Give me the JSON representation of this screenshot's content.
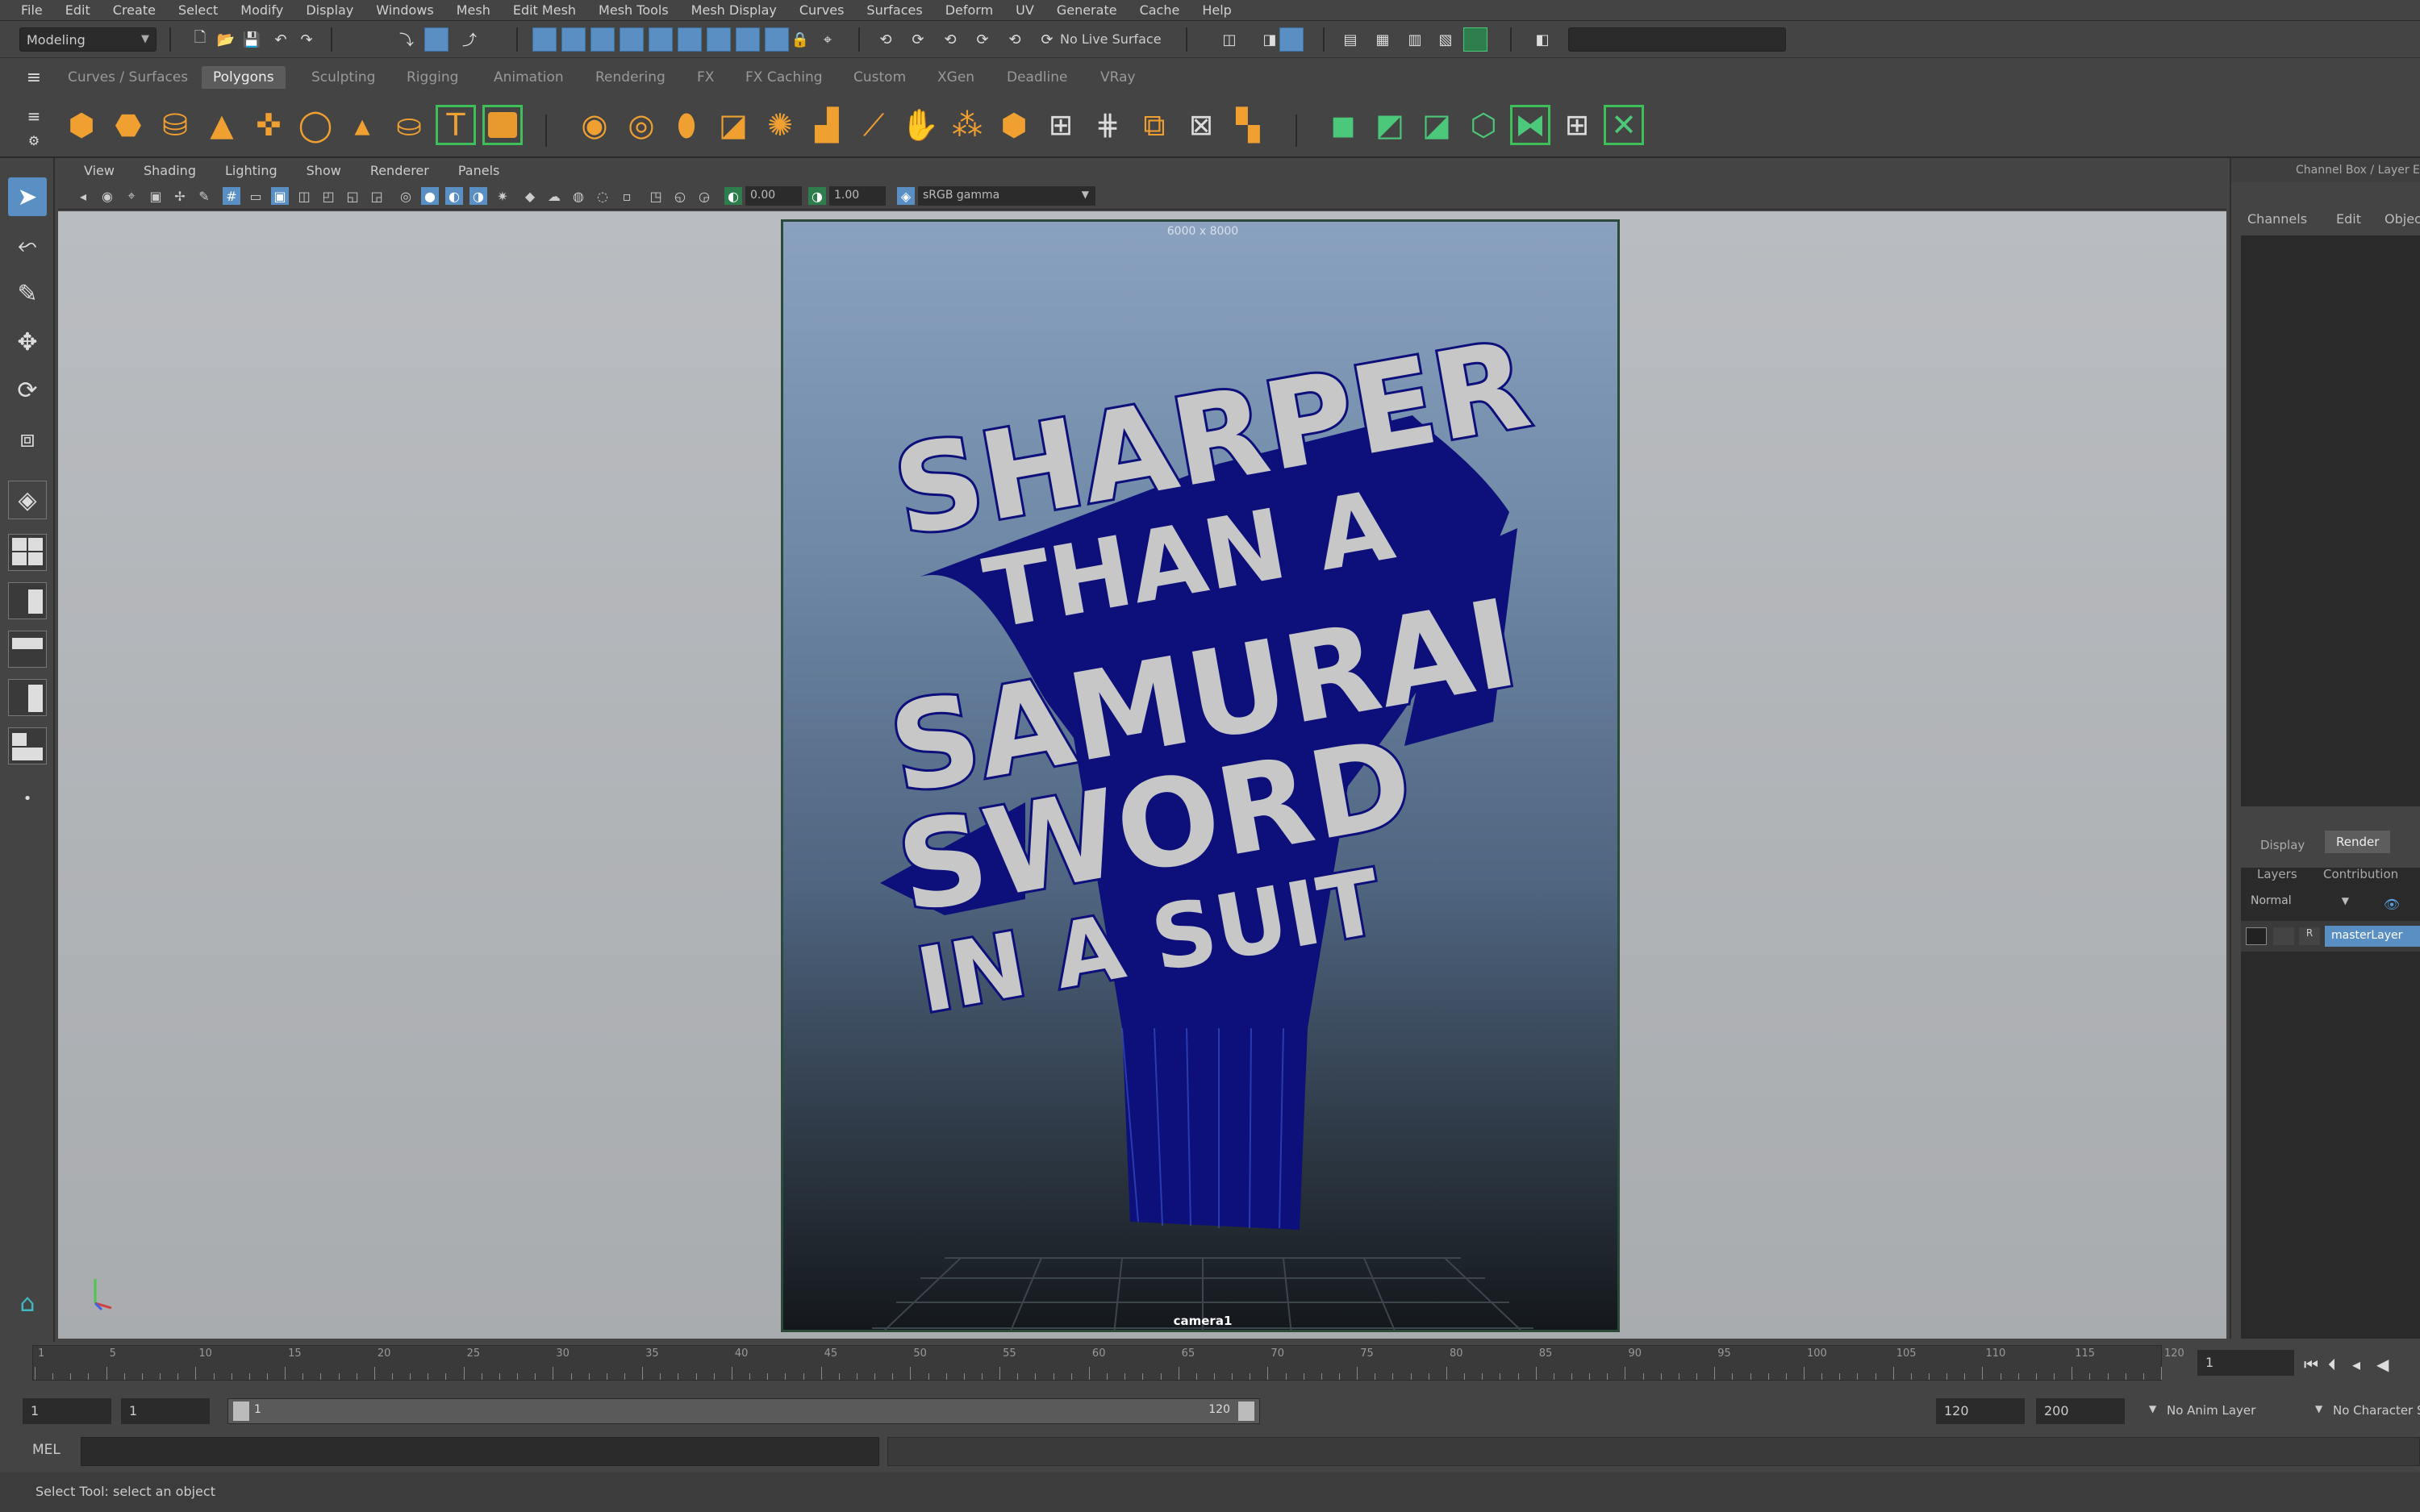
{
  "menubar": {
    "items": [
      "File",
      "Edit",
      "Create",
      "Select",
      "Modify",
      "Display",
      "Windows",
      "Mesh",
      "Edit Mesh",
      "Mesh Tools",
      "Mesh Display",
      "Curves",
      "Surfaces",
      "Deform",
      "UV",
      "Generate",
      "Cache",
      "Help"
    ]
  },
  "statusline": {
    "mode_value": "Modeling",
    "live_surface": "No Live Surface"
  },
  "shelf_tabs": {
    "items": [
      "Curves / Surfaces",
      "Polygons",
      "Sculpting",
      "Rigging",
      "Animation",
      "Rendering",
      "FX",
      "FX Caching",
      "Custom",
      "XGen",
      "Deadline",
      "VRay"
    ],
    "active": "Polygons"
  },
  "panel": {
    "menu": [
      "View",
      "Shading",
      "Lighting",
      "Show",
      "Renderer",
      "Panels"
    ],
    "near_clip": "0.00",
    "far_clip": "1.00",
    "color_space": "sRGB gamma"
  },
  "viewport": {
    "resolution": "6000 x 8000",
    "camera": "camera1",
    "artwork_lines": [
      "SHARPER",
      "THAN A",
      "SAMURAI",
      "SWORD",
      "IN A SUIT"
    ],
    "text_face_color": "#c7c7c7",
    "extrusion_color": "#0d0f7a",
    "bg_top": "#8aa2c0",
    "bg_bottom": "#14181c"
  },
  "channelbox": {
    "title": "Channel Box / Layer Editor",
    "tabs": [
      "Channels",
      "Edit",
      "Object"
    ],
    "layer_tabs": [
      "Display",
      "Render"
    ],
    "layer_active": "Render",
    "layer_subtabs": [
      "Layers",
      "Contribution"
    ],
    "blend_mode": "Normal",
    "layer_name": "masterLayer"
  },
  "timeslider": {
    "ticks": [
      "1",
      "5",
      "10",
      "15",
      "20",
      "25",
      "30",
      "35",
      "40",
      "45",
      "50",
      "55",
      "60",
      "65",
      "70",
      "75",
      "80",
      "85",
      "90",
      "95",
      "100",
      "105",
      "110",
      "115",
      "120"
    ],
    "current_frame": "1"
  },
  "rangeslider": {
    "start": "1",
    "playback_start": "1",
    "range_start_label": "1",
    "range_end_label": "120",
    "playback_end": "120",
    "end": "200",
    "anim_layer": "No Anim Layer",
    "character": "No Character Set"
  },
  "commandline": {
    "label": "MEL"
  },
  "helpline": {
    "text": "Select Tool: select an object"
  }
}
